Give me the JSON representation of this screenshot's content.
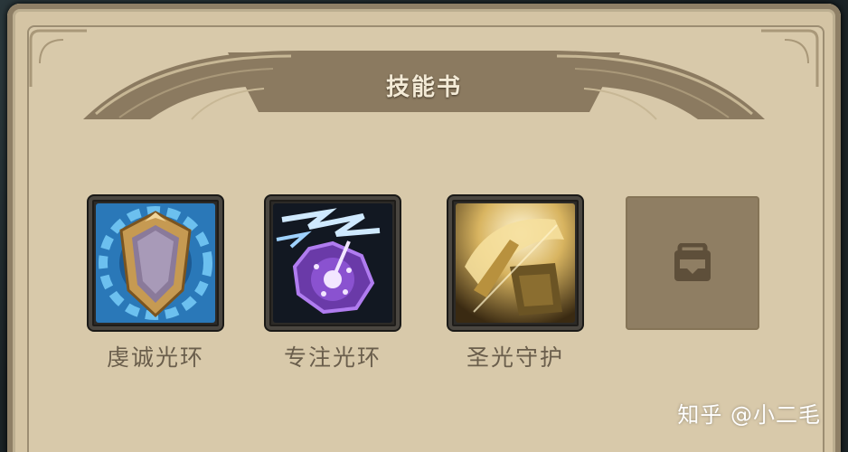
{
  "window": {
    "title": "技能书"
  },
  "skills": [
    {
      "label": "虔诚光环",
      "icon": "shield-aura-icon"
    },
    {
      "label": "专注光环",
      "icon": "lightning-orb-icon"
    },
    {
      "label": "圣光守护",
      "icon": "holy-guard-icon"
    }
  ],
  "locked_slot": {
    "icon": "lock-icon"
  },
  "watermark": "知乎 @小二毛",
  "colors": {
    "panel": "#d4c4a4",
    "label": "#6a5e4c",
    "header_band": "#8b7a60",
    "locked_slot": "#8f7e63"
  }
}
